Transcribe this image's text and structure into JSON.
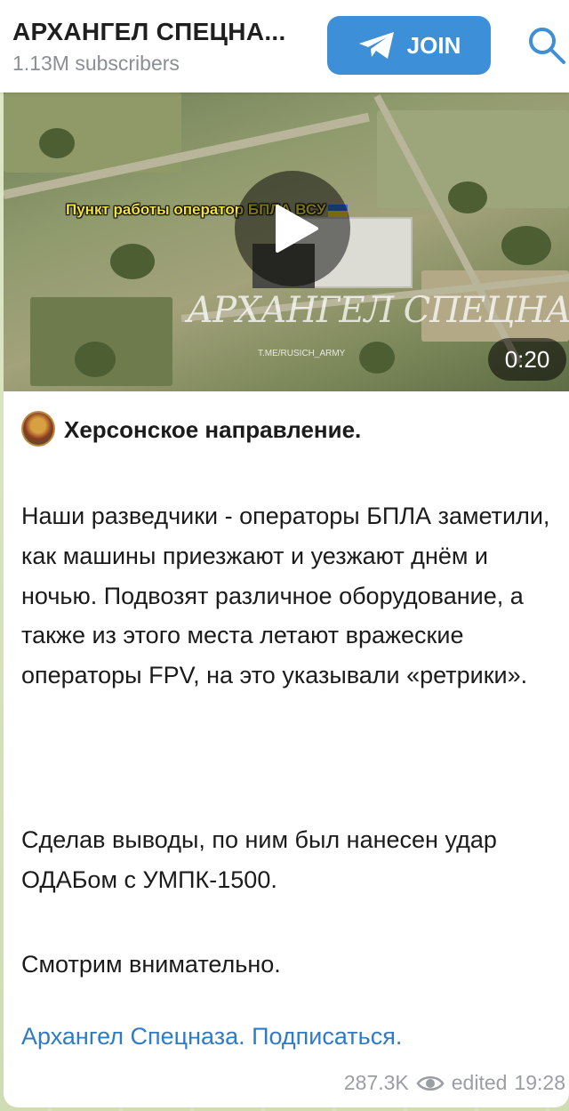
{
  "header": {
    "channel_title": "АРХАНГЕЛ СПЕЦНА...",
    "subscribers": "1.13M subscribers",
    "join_label": "JOIN"
  },
  "video": {
    "overlay_text": "Пункт работы оператор БПЛА ВСУ",
    "watermark": "АРХАНГЕЛ СПЕЦНАЗА",
    "watermark_sub": "T.ME/RUSICH_ARMY",
    "duration": "0:20"
  },
  "post": {
    "headline": "Херсонское направление.",
    "paragraph1": "Наши разведчики - операторы БПЛА заметили, как машины приезжают и уезжают днём и ночью. Подвозят различное оборудование, а также из этого места летают вражеские операторы FPV, на это указывали «ретрики».",
    "paragraph2": "Сделав выводы, по ним был нанесен удар ОДАБом с УМПК-1500.",
    "paragraph3": "Смотрим внимательно.",
    "subscribe_link": "Архангел Спецназа. Подписаться.",
    "views": "287.3K",
    "edited_label": "edited",
    "time": "19:28"
  },
  "colors": {
    "accent": "#3d8fd8",
    "link": "#2f7cc4",
    "background": "#d9e4c5"
  }
}
